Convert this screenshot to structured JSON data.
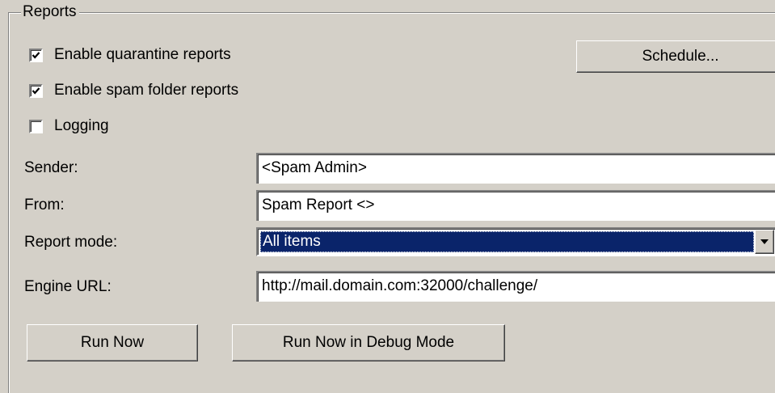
{
  "group": {
    "title": "Reports"
  },
  "checkboxes": [
    {
      "label": "Enable quarantine reports",
      "checked": true
    },
    {
      "label": "Enable spam folder reports",
      "checked": true
    },
    {
      "label": "Logging",
      "checked": false
    }
  ],
  "schedule_button": "Schedule...",
  "fields": {
    "sender": {
      "label": "Sender:",
      "value": "<Spam Admin>"
    },
    "from": {
      "label": "From:",
      "value": "Spam Report <>"
    },
    "report_mode": {
      "label": "Report mode:",
      "value": "All items"
    },
    "engine_url": {
      "label": "Engine URL:",
      "value": "http://mail.domain.com:32000/challenge/"
    }
  },
  "buttons": {
    "run_now": "Run Now",
    "run_debug": "Run Now in Debug Mode"
  },
  "colors": {
    "face": "#d4d0c8",
    "selection": "#0a246a",
    "field_bg": "#ffffff"
  },
  "icons": {
    "check": "check-mark-icon",
    "dropdown": "triangle-down-icon"
  }
}
